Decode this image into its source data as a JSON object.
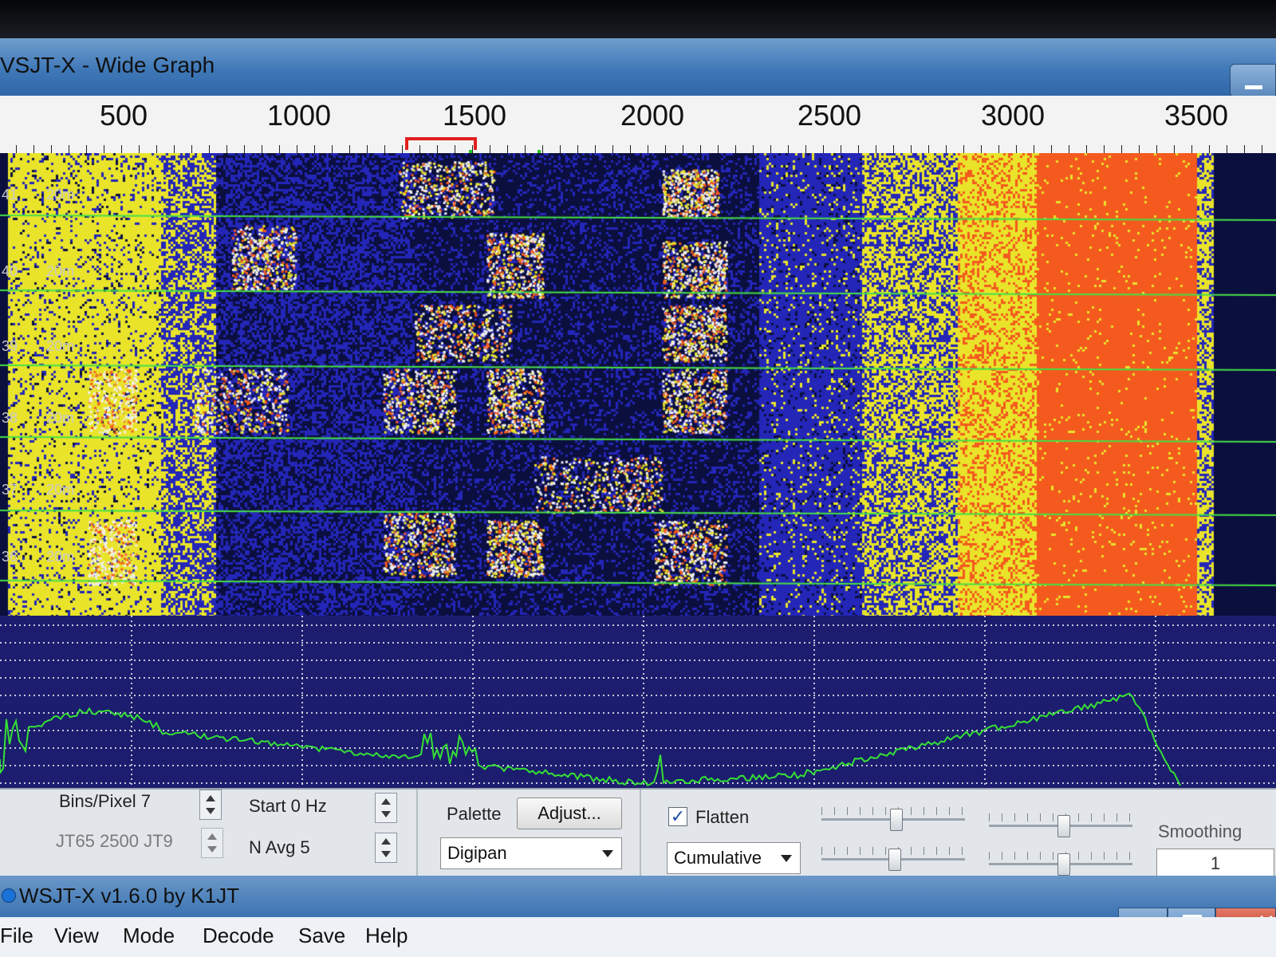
{
  "wide_graph": {
    "title": "VSJT-X - Wide Graph",
    "frequency_ticks": [
      "500",
      "1000",
      "1500",
      "2000",
      "2500",
      "3000",
      "3500"
    ],
    "row_labels": [
      "41",
      "40",
      "39",
      "38",
      "37",
      "36"
    ],
    "band_label": "20m"
  },
  "controls": {
    "bins_pixel": "Bins/Pixel  7",
    "mode_line": "JT65  2500  JT9",
    "start": "Start 0 Hz",
    "n_avg": "N Avg 5",
    "palette_label": "Palette",
    "adjust_button": "Adjust...",
    "palette_value": "Digipan",
    "flatten_label": "Flatten",
    "flatten_checked": "✓",
    "spectrum_mode": "Cumulative",
    "smoothing_label": "Smoothing",
    "smoothing_value": "1"
  },
  "main_window": {
    "title": "WSJT-X   v1.6.0   by K1JT",
    "menu": [
      "File",
      "View",
      "Mode",
      "Decode",
      "Save",
      "Help"
    ]
  },
  "colors": {
    "waterfall_bg": "#0b0f3e",
    "noise_blue": "#2426b8",
    "noise_yellow": "#e9e42a",
    "hot_orange": "#f45a1e",
    "grid_green": "#46e046",
    "spectrum_line": "#35e035"
  }
}
